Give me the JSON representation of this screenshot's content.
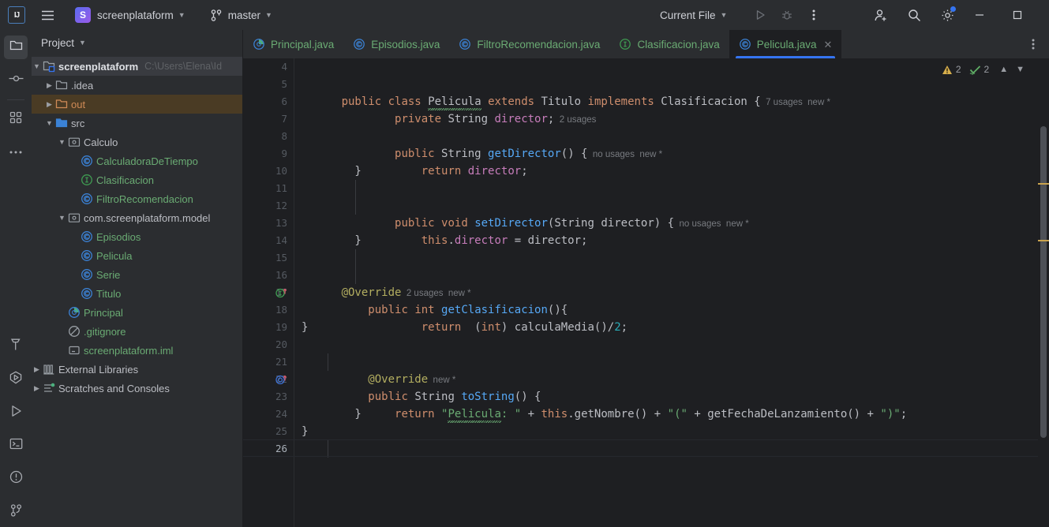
{
  "titlebar": {
    "logo_text": "IJ",
    "project_initial": "S",
    "project_name": "screenplataform",
    "branch": "master",
    "run_config": "Current File",
    "icons": {
      "hamburger": "hamburger-icon",
      "vcs": "branch-icon",
      "run": "run-icon",
      "debug": "debug-icon",
      "more": "more-vertical-icon",
      "share": "add-user-icon",
      "search": "search-icon",
      "settings": "gear-icon",
      "minimize": "minimize-icon",
      "maximize": "maximize-icon"
    },
    "accent_color": "#3574f0"
  },
  "activitybar": {
    "top": [
      {
        "name": "project-tool-window",
        "icon": "folder-icon",
        "active": true
      },
      {
        "name": "commit-tool-window",
        "icon": "commit-icon",
        "active": false
      },
      {
        "name": "structure-tool-window",
        "icon": "structure-icon",
        "active": false
      },
      {
        "name": "more-tool-windows",
        "icon": "more-horizontal-icon",
        "active": false
      }
    ],
    "bottom": [
      {
        "name": "build-tool-window",
        "icon": "hammer-icon"
      },
      {
        "name": "coverage-tool-window",
        "icon": "coverage-icon"
      },
      {
        "name": "run-tool-window",
        "icon": "run-icon"
      },
      {
        "name": "terminal-tool-window",
        "icon": "terminal-icon"
      },
      {
        "name": "problems-tool-window",
        "icon": "warning-circle-icon"
      },
      {
        "name": "version-control-tool-window",
        "icon": "branch-icon"
      }
    ]
  },
  "project_panel": {
    "title": "Project",
    "tree": [
      {
        "label": "screenplataform",
        "path": "C:\\Users\\Elena\\Id",
        "icon": "module-icon",
        "indent": 0,
        "arrow": "down",
        "style": "bold",
        "selected": "grey"
      },
      {
        "label": ".idea",
        "icon": "folder-icon",
        "indent": 1,
        "arrow": "right",
        "style": "plain",
        "selected": ""
      },
      {
        "label": "out",
        "icon": "folder-orange-icon",
        "indent": 1,
        "arrow": "right",
        "style": "orange",
        "selected": "amber"
      },
      {
        "label": "src",
        "icon": "folder-blue-icon",
        "indent": 1,
        "arrow": "down",
        "style": "plain",
        "selected": ""
      },
      {
        "label": "Calculo",
        "icon": "package-icon",
        "indent": 2,
        "arrow": "down",
        "style": "plain",
        "selected": ""
      },
      {
        "label": "CalculadoraDeTiempo",
        "icon": "class-icon",
        "indent": 3,
        "arrow": "none",
        "style": "green",
        "selected": ""
      },
      {
        "label": "Clasificacion",
        "icon": "interface-icon",
        "indent": 3,
        "arrow": "none",
        "style": "green",
        "selected": ""
      },
      {
        "label": "FiltroRecomendacion",
        "icon": "class-icon",
        "indent": 3,
        "arrow": "none",
        "style": "green",
        "selected": ""
      },
      {
        "label": "com.screenplataform.model",
        "icon": "package-icon",
        "indent": 2,
        "arrow": "down",
        "style": "plain",
        "selected": ""
      },
      {
        "label": "Episodios",
        "icon": "class-icon",
        "indent": 3,
        "arrow": "none",
        "style": "green",
        "selected": ""
      },
      {
        "label": "Pelicula",
        "icon": "class-icon",
        "indent": 3,
        "arrow": "none",
        "style": "green",
        "selected": ""
      },
      {
        "label": "Serie",
        "icon": "class-icon",
        "indent": 3,
        "arrow": "none",
        "style": "green",
        "selected": ""
      },
      {
        "label": "Titulo",
        "icon": "class-icon",
        "indent": 3,
        "arrow": "none",
        "style": "green",
        "selected": ""
      },
      {
        "label": "Principal",
        "icon": "runnable-class-icon",
        "indent": 2,
        "arrow": "none",
        "style": "green",
        "selected": ""
      },
      {
        "label": ".gitignore",
        "icon": "gitignore-icon",
        "indent": 2,
        "arrow": "none",
        "style": "green",
        "selected": ""
      },
      {
        "label": "screenplataform.iml",
        "icon": "iml-icon",
        "indent": 2,
        "arrow": "none",
        "style": "green",
        "selected": ""
      },
      {
        "label": "External Libraries",
        "icon": "library-icon",
        "indent": 0,
        "arrow": "right",
        "style": "plain",
        "selected": ""
      },
      {
        "label": "Scratches and Consoles",
        "icon": "scratches-icon",
        "indent": 0,
        "arrow": "right",
        "style": "plain",
        "selected": ""
      }
    ]
  },
  "tabs": [
    {
      "label": "Principal.java",
      "icon": "runnable-class-icon",
      "active": false,
      "closable": false
    },
    {
      "label": "Episodios.java",
      "icon": "class-icon",
      "active": false,
      "closable": false
    },
    {
      "label": "FiltroRecomendacion.java",
      "icon": "class-icon",
      "active": false,
      "closable": false
    },
    {
      "label": "Clasificacion.java",
      "icon": "interface-icon",
      "active": false,
      "closable": false
    },
    {
      "label": "Pelicula.java",
      "icon": "class-icon",
      "active": true,
      "closable": true
    }
  ],
  "inspections": {
    "warning_count": "2",
    "check_count": "2",
    "prev_icon": "chevron-up-icon",
    "next_icon": "chevron-down-icon",
    "warning_icon": "warning-triangle-icon",
    "check_icon": "check-squiggle-icon"
  },
  "editor": {
    "file": "Pelicula.java",
    "first_visible_line": "4",
    "last_visible_line": "26",
    "caret_line": "26",
    "line_numbers": [
      "4",
      "5",
      "6",
      "7",
      "8",
      "9",
      "10",
      "11",
      "12",
      "13",
      "14",
      "15",
      "16",
      "17",
      "18",
      "19",
      "20",
      "21",
      "22",
      "23",
      "24",
      "25",
      "26"
    ],
    "gutter_marks": [
      {
        "line": "17",
        "icon": "implementing-method-icon"
      },
      {
        "line": "22",
        "icon": "overriding-method-icon"
      }
    ],
    "code_lines": [
      {
        "n": "4",
        "text": ""
      },
      {
        "n": "5",
        "text": "public class Pelicula extends Titulo implements Clasificacion {",
        "hint": "7 usages   new *"
      },
      {
        "n": "6",
        "text": "        private String director;",
        "hint": "2 usages"
      },
      {
        "n": "7",
        "text": ""
      },
      {
        "n": "8",
        "text": "        public String getDirector() {",
        "hint": "no usages   new *"
      },
      {
        "n": "9",
        "text": "            return director;"
      },
      {
        "n": "10",
        "text": "        }"
      },
      {
        "n": "11",
        "text": ""
      },
      {
        "n": "12",
        "text": "        public void setDirector(String director) {",
        "hint": "no usages   new *"
      },
      {
        "n": "13",
        "text": "            this.director = director;"
      },
      {
        "n": "14",
        "text": "        }"
      },
      {
        "n": "15",
        "text": ""
      },
      {
        "n": "16",
        "text": "@Override",
        "hint": "2 usages   new *"
      },
      {
        "n": "17",
        "text": "    public int getClasificacion(){"
      },
      {
        "n": "18",
        "text": "            return  (int) calculaMedia()/2;"
      },
      {
        "n": "19",
        "text": "}"
      },
      {
        "n": "20",
        "text": ""
      },
      {
        "n": "21",
        "text": "    @Override",
        "hint": "new *"
      },
      {
        "n": "22",
        "text": "    public String toString() {"
      },
      {
        "n": "23",
        "text": "        return \"Pelicula: \" + this.getNombre() + \"(\" + getFechaDeLanzamiento() + \")\";"
      },
      {
        "n": "24",
        "text": "        }"
      },
      {
        "n": "25",
        "text": "}"
      },
      {
        "n": "26",
        "text": ""
      }
    ],
    "markers": [
      {
        "name": "warning-marker-1",
        "top_pct": "27"
      },
      {
        "name": "warning-marker-2",
        "top_pct": "39"
      }
    ]
  },
  "colors": {
    "bg_editor": "#1e1f22",
    "bg_chrome": "#2b2d30",
    "accent": "#3574f0",
    "keyword": "#cf8e6d",
    "string": "#6aab73",
    "method": "#56a8f5",
    "field": "#c77dbb",
    "annotation": "#b3ae60",
    "number": "#2aacb8",
    "selection_amber": "#4a3b24"
  }
}
